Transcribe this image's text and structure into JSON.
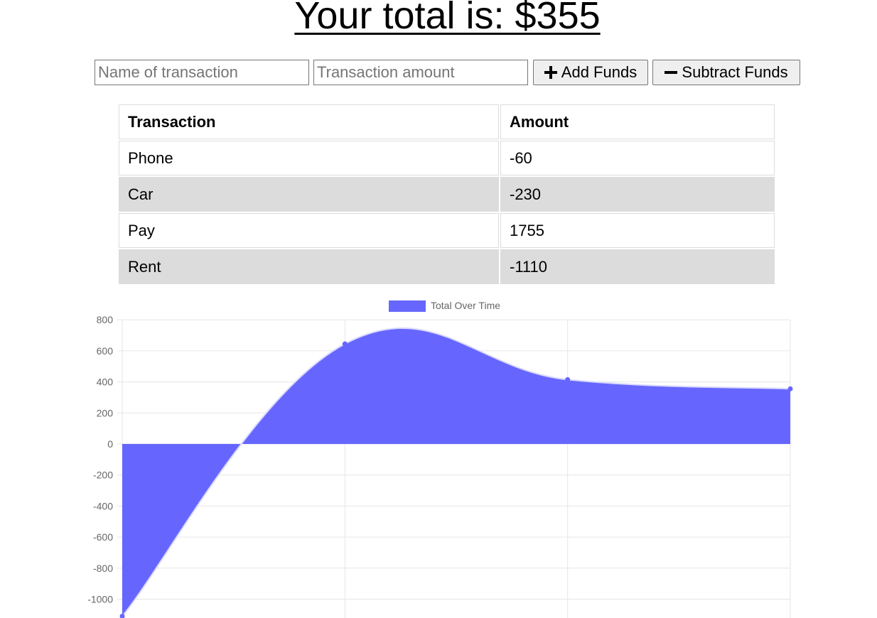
{
  "header": {
    "total_label": "Your total is: $355"
  },
  "form": {
    "name_placeholder": "Name of transaction",
    "amount_placeholder": "Transaction amount",
    "add_label": "Add Funds",
    "add_icon": "plus-icon",
    "subtract_label": "Subtract Funds",
    "subtract_icon": "minus-icon"
  },
  "table": {
    "columns": [
      "Transaction",
      "Amount"
    ],
    "rows": [
      {
        "name": "Phone",
        "amount": "-60"
      },
      {
        "name": "Car",
        "amount": "-230"
      },
      {
        "name": "Pay",
        "amount": "1755"
      },
      {
        "name": "Rent",
        "amount": "-1110"
      }
    ]
  },
  "colors": {
    "fill": "#6666ff",
    "point": "#6666ff",
    "grid": "#e6e6e6",
    "tick": "#666666",
    "shaded_row": "#dcdcdc"
  },
  "chart_data": {
    "type": "area",
    "title": "",
    "xlabel": "",
    "ylabel": "",
    "series": [
      {
        "name": "Total Over Time",
        "values": [
          -1110,
          645,
          415,
          355
        ]
      }
    ],
    "yticks": [
      800,
      600,
      400,
      200,
      0,
      -200,
      -400,
      -600,
      -800,
      -1000
    ],
    "ylim": [
      -1110,
      800
    ],
    "grid": true,
    "legend": "top-center"
  }
}
